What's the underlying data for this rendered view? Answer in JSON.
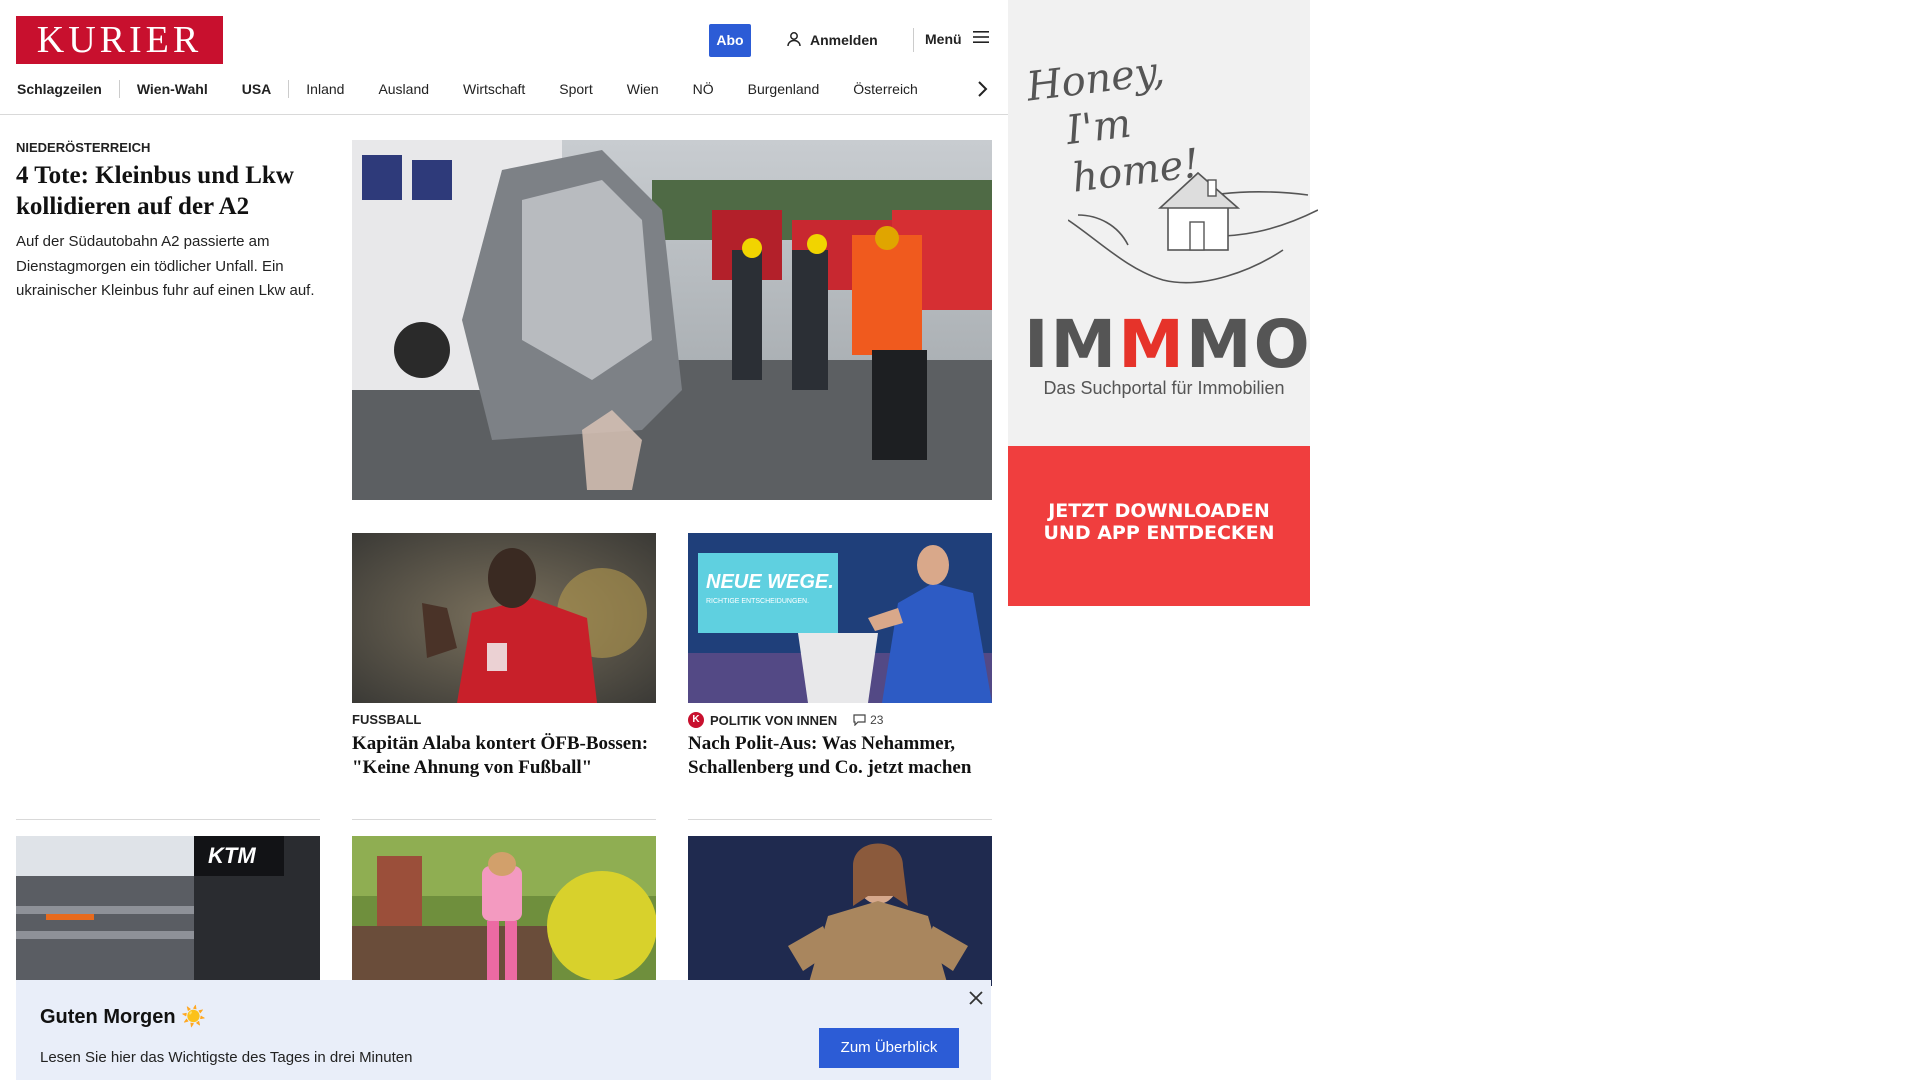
{
  "header": {
    "logo_text": "KURIER",
    "abo_label": "Abo",
    "login_label": "Anmelden",
    "menu_label": "Menü"
  },
  "nav": {
    "items": [
      "Schlagzeilen",
      "Wien-Wahl",
      "USA",
      "Inland",
      "Ausland",
      "Wirtschaft",
      "Sport",
      "Wien",
      "NÖ",
      "Burgenland",
      "Österreich"
    ]
  },
  "lead": {
    "kicker": "NIEDERÖSTERREICH",
    "title": "4 Tote: Kleinbus und Lkw kollidieren auf der A2",
    "teaser": "Auf der Südautobahn A2 passierte am Dienstagmorgen ein tödlicher Unfall. Ein ukrainischer Kleinbus fuhr auf einen Lkw auf.",
    "image_alt": "Unfallstelle auf der A2 mit Feuerwehr"
  },
  "cards": [
    {
      "kicker": "FUSSBALL",
      "title": "Kapitän Alaba kontert ÖFB-Bossen: \"Keine Ahnung von Fußball\""
    },
    {
      "kicker": "POLITIK VON INNEN",
      "comments": "23",
      "title": "Nach Polit-Aus: Was Nehammer, Schallenberg und Co. jetzt machen",
      "image_screen_text": "NEUE WEGE.",
      "image_screen_subtext": "RICHTIGE ENTSCHEIDUNGEN."
    }
  ],
  "row3": {
    "ktm_sign": "KTM"
  },
  "ad": {
    "script_line1": "Honey,",
    "script_line2": "I'm home!",
    "logo_pre": "IM",
    "logo_red": "M",
    "logo_post": "MO",
    "subtitle": "Das Suchportal für Immobilien",
    "cta_line1": "JETZT DOWNLOADEN",
    "cta_line2": "UND APP ENTDECKEN"
  },
  "notice": {
    "title": "Guten Morgen ☀️",
    "text": "Lesen Sie hier das Wichtigste des Tages in drei Minuten",
    "button": "Zum Überblick"
  },
  "colors": {
    "brand_red": "#c8102e",
    "button_blue": "#2c5cd6",
    "ad_red": "#f03e3e",
    "notice_bg": "#e9eef9"
  }
}
